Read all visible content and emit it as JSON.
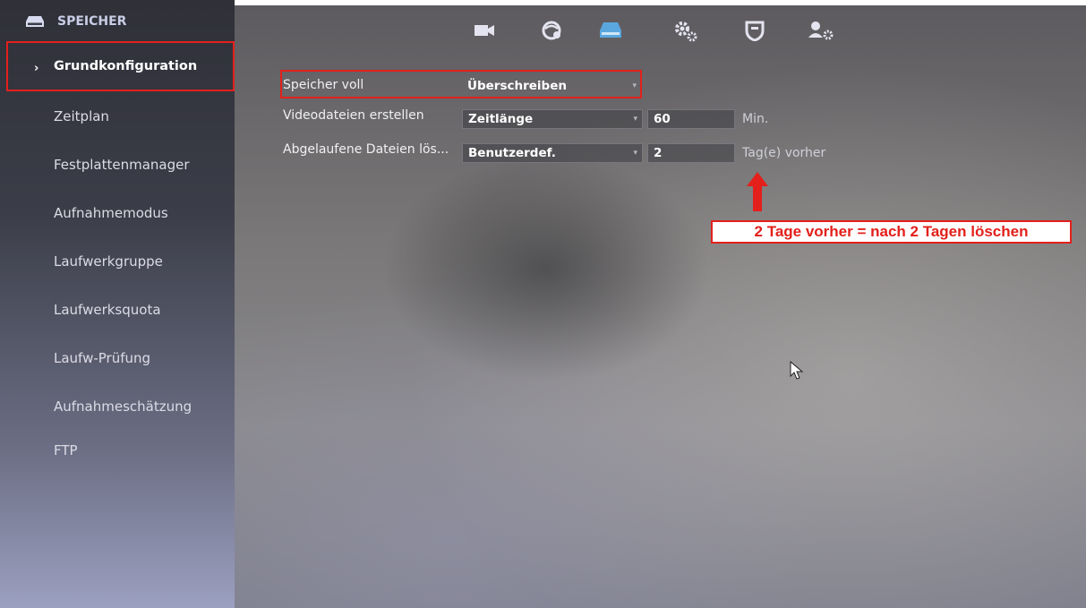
{
  "sidebar": {
    "title": "SPEICHER",
    "items": [
      {
        "label": "Grundkonfiguration",
        "active": true
      },
      {
        "label": "Zeitplan"
      },
      {
        "label": "Festplattenmanager"
      },
      {
        "label": "Aufnahmemodus"
      },
      {
        "label": "Laufwerkgruppe"
      },
      {
        "label": "Laufwerksquota"
      },
      {
        "label": "Laufw-Prüfung"
      },
      {
        "label": "Aufnahmeschätzung"
      },
      {
        "label": "FTP"
      }
    ]
  },
  "toolbar": {
    "icons": [
      "camera-icon",
      "network-icon",
      "storage-icon",
      "system-settings-icon",
      "security-shield-icon",
      "account-icon"
    ],
    "active": "storage-icon"
  },
  "settings": {
    "disk_full": {
      "label": "Speicher voll",
      "value": "Überschreiben"
    },
    "create_files": {
      "label": "Videodateien erstellen",
      "value": "Zeitlänge",
      "number": "60",
      "unit": "Min."
    },
    "delete_expired": {
      "label": "Abgelaufene Dateien lös...",
      "value": "Benutzerdef.",
      "number": "2",
      "unit": "Tag(e) vorher"
    }
  },
  "annotation": {
    "text": "2 Tage vorher = nach 2 Tagen löschen",
    "color": "#e3201b"
  },
  "colors": {
    "sidebar_text": "#dcdce6",
    "accent_storage": "#5aa7e0",
    "highlight": "#e3201b"
  }
}
